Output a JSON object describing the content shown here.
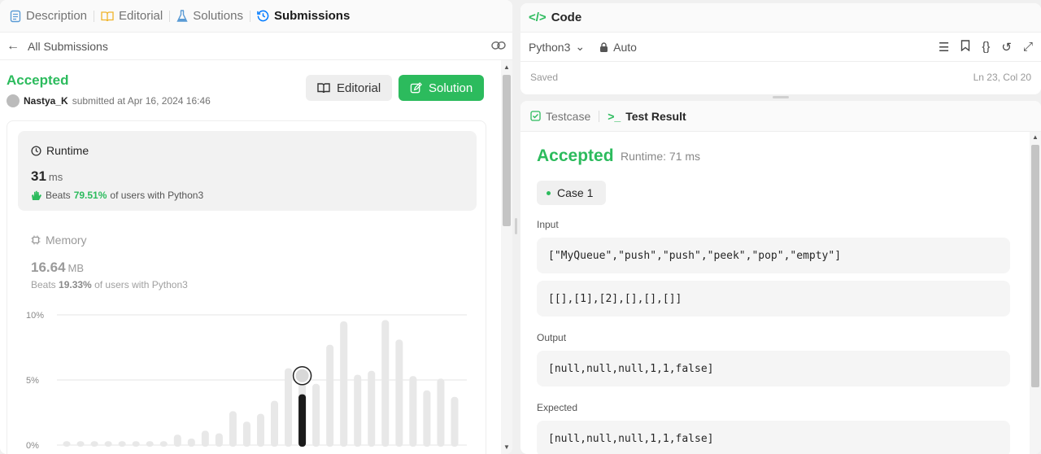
{
  "tabs": [
    {
      "label": "Description",
      "icon": "description-icon"
    },
    {
      "label": "Editorial",
      "icon": "book-icon"
    },
    {
      "label": "Solutions",
      "icon": "flask-icon"
    },
    {
      "label": "Submissions",
      "icon": "history-icon"
    }
  ],
  "subnav": {
    "back_label": "All Submissions"
  },
  "submission": {
    "status": "Accepted",
    "user": "Nastya_K",
    "submitted_text": "submitted at Apr 16, 2024 16:46",
    "editorial_button": "Editorial",
    "solution_button": "Solution"
  },
  "runtime": {
    "label": "Runtime",
    "value": "31",
    "unit": "ms",
    "beats_prefix": "Beats",
    "beats_pct": "79.51%",
    "beats_suffix": "of users with Python3"
  },
  "memory": {
    "label": "Memory",
    "value": "16.64",
    "unit": "MB",
    "beats_prefix": "Beats",
    "beats_pct": "19.33%",
    "beats_suffix": "of users with Python3"
  },
  "chart_data": {
    "type": "bar",
    "ytick_labels": [
      "10%",
      "5%",
      "0%"
    ],
    "yticks": [
      10,
      5,
      0
    ],
    "ylim": [
      0,
      10
    ],
    "values": [
      0.3,
      0.3,
      0.3,
      0.3,
      0.3,
      0.3,
      0.3,
      0.3,
      0.8,
      0.5,
      1.1,
      0.9,
      2.6,
      1.8,
      2.4,
      3.4,
      5.9,
      5.7,
      4.7,
      7.7,
      9.5,
      5.4,
      5.7,
      9.6,
      8.1,
      5.3,
      4.2,
      5.1,
      3.7
    ],
    "highlight_index": 17,
    "highlight_value": 3.9,
    "colors": {
      "bar": "#e8e8e8",
      "highlight": "#1a1a1a",
      "grid": "#e6e6e6"
    }
  },
  "code": {
    "title": "Code",
    "language": "Python3",
    "mode": "Auto",
    "status": "Saved",
    "cursor": "Ln 23, Col 20"
  },
  "result": {
    "tab_testcase": "Testcase",
    "tab_result": "Test Result",
    "status": "Accepted",
    "runtime": "Runtime: 71 ms",
    "case_label": "Case 1",
    "input_label": "Input",
    "input_line1": "[\"MyQueue\",\"push\",\"push\",\"peek\",\"pop\",\"empty\"]",
    "input_line2": "[[],[1],[2],[],[],[]]",
    "output_label": "Output",
    "output_value": "[null,null,null,1,1,false]",
    "expected_label": "Expected",
    "expected_value": "[null,null,null,1,1,false]"
  },
  "colors": {
    "accent_green": "#2cbb5d",
    "active_tab_icon": "#007aff"
  }
}
